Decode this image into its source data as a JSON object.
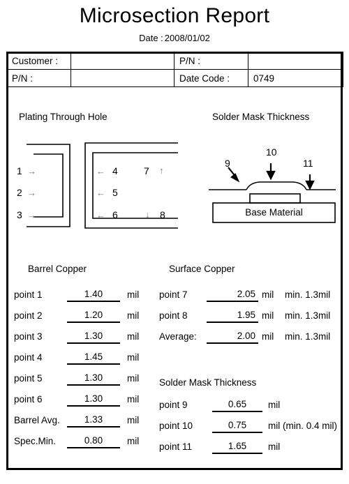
{
  "document": {
    "title": "Microsection Report",
    "date_label": "Date :",
    "date_value": "2008/01/02"
  },
  "info_table": {
    "rows": [
      {
        "label1": "Customer :",
        "value1": "",
        "label2": "P/N :",
        "value2": ""
      },
      {
        "label1": "P/N :",
        "value1": "",
        "label2": "Date Code :",
        "value2": "0749"
      }
    ]
  },
  "diagrams": {
    "pth": {
      "title": "Plating Through Hole",
      "labels": [
        "1",
        "2",
        "3",
        "4",
        "5",
        "6",
        "7",
        "8"
      ],
      "arrows": {
        "right": "→",
        "left": "←",
        "up": "↑",
        "down": "↓"
      }
    },
    "solder_mask": {
      "title": "Solder Mask Thickness",
      "labels": [
        "9",
        "10",
        "11"
      ],
      "base_material": "Base Material"
    }
  },
  "barrel_copper": {
    "heading": "Barrel  Copper",
    "rows": [
      {
        "label": "point  1",
        "value": "1.40",
        "unit": "mil"
      },
      {
        "label": "point  2",
        "value": "1.20",
        "unit": "mil"
      },
      {
        "label": "point  3",
        "value": "1.30",
        "unit": "mil"
      },
      {
        "label": "point  4",
        "value": "1.45",
        "unit": "mil"
      },
      {
        "label": "point  5",
        "value": "1.30",
        "unit": "mil"
      },
      {
        "label": "point  6",
        "value": "1.30",
        "unit": "mil"
      },
      {
        "label": "Barrel Avg.",
        "value": "1.33",
        "unit": "mil"
      },
      {
        "label": "Spec.Min.",
        "value": "0.80",
        "unit": "mil"
      }
    ]
  },
  "surface_copper": {
    "heading": "Surface  Copper",
    "rows": [
      {
        "label": "point  7",
        "value": "2.05",
        "unit": "mil",
        "note": "min. 1.3mil"
      },
      {
        "label": "point  8",
        "value": "1.95",
        "unit": "mil",
        "note": "min. 1.3mil"
      },
      {
        "label": "Average:",
        "value": "2.00",
        "unit": "mil",
        "note": "min. 1.3mil"
      }
    ]
  },
  "solder_mask_thickness": {
    "heading": "Solder Mask Thickness",
    "rows": [
      {
        "label": "point  9",
        "value": "0.65",
        "unit": "mil"
      },
      {
        "label": "point 10",
        "value": "0.75",
        "unit": "mil (min. 0.4 mil)"
      },
      {
        "label": "point 11",
        "value": "1.65",
        "unit": "mil"
      }
    ]
  },
  "colors": {
    "ink": "#000000",
    "paper": "#ffffff",
    "arrow_gray": "#777777"
  }
}
